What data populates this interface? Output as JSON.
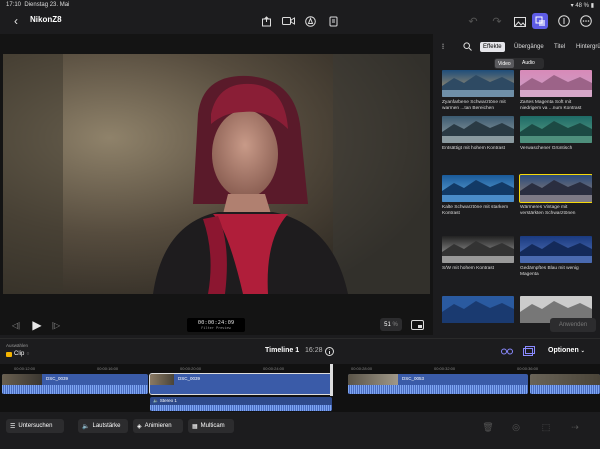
{
  "status": {
    "time": "17:10",
    "date": "Dienstag 23. Mai",
    "battery": "48 %"
  },
  "header": {
    "title": "NikonZ8"
  },
  "viewer": {
    "timecode": "00:00:24:09",
    "timecode_sub": "Filter Preview",
    "zoom": "51",
    "zoom_unit": "%"
  },
  "sidebar": {
    "tabs": [
      "Effekte",
      "Übergänge",
      "Titel",
      "Hintergrü"
    ],
    "segments": [
      "Video",
      "Audio"
    ],
    "effects": [
      {
        "label": "Zyanfarbene Schwarztöne mit warmen ...tan Bereichen"
      },
      {
        "label": "Zartes Magenta Soft mit niedrigem va ...num Kontrast"
      },
      {
        "label": "Entsättigt mit hohem Kontrast"
      },
      {
        "label": "Verwaschener Grüntisch"
      },
      {
        "label": "Kalte Schwarztöne mit starkem Kontrast"
      },
      {
        "label": "Wärmeres Vintage mit verstärkten Schwarztönen"
      },
      {
        "label": "S/W mit hohem Kontrast"
      },
      {
        "label": "Gedämpftes Blau mit wenig Magenta"
      },
      {
        "label": ""
      },
      {
        "label": ""
      }
    ],
    "apply_label": "Anwenden"
  },
  "timeline": {
    "selection_label": "Auswählen",
    "clip_label": "Clip",
    "name": "Timeline 1",
    "duration": "16:28",
    "options_label": "Optionen",
    "ruler": [
      "00:00:12:00",
      "00:00:16:00",
      "00:00:20:00",
      "00:00:24:00",
      "00:00:28:00",
      "00:00:32:00",
      "00:00:36:00"
    ],
    "clips": [
      {
        "name": "DSC_0039"
      },
      {
        "name": "DSC_0039"
      },
      {
        "name": "DSC_0053"
      }
    ],
    "audio_clip": "Stereo 1"
  },
  "toolbar": {
    "inspect": "Untersuchen",
    "volume": "Lautstärke",
    "animate": "Animieren",
    "multicam": "Multicam"
  }
}
